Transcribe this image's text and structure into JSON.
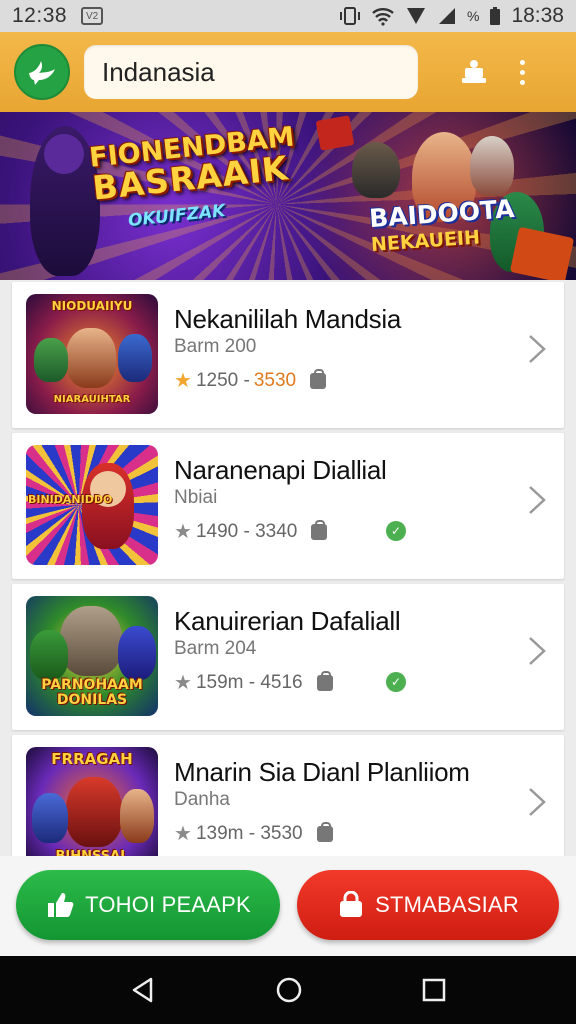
{
  "status_bar": {
    "time_left": "12:38",
    "battery_text": "%",
    "time_right": "18:38"
  },
  "app_bar": {
    "search_value": "Indanasia"
  },
  "banner": {
    "title_line1": "FIONENDBAM",
    "title_line2": "BASRAAIK",
    "subtitle": "OKUIFZAK",
    "right_line1": "BAIDOOTA",
    "right_line2": "NEKAUEIH"
  },
  "games": [
    {
      "title": "Nekanililah Mandsia",
      "subtitle": "Barm 200",
      "rating": "1250 -",
      "rating_hi": "3530",
      "verified": false,
      "thumb_text_top": "NIODUAIIYU",
      "thumb_text_bottom": "NIARAUIHTAR",
      "colors": {
        "bg1": "#d44b1a",
        "bg2": "#5b1a7a",
        "text": "#ffd23f"
      }
    },
    {
      "title": "Naranenapi Diallial",
      "subtitle": "Nbiai",
      "rating": "1490 - 3340",
      "rating_hi": "",
      "verified": true,
      "thumb_text_top": "BINIDANIDDO",
      "thumb_text_bottom": "",
      "colors": {
        "bg1": "#2a6bd6",
        "bg2": "#e0387a",
        "text": "#ffd23f"
      }
    },
    {
      "title": "Kanuirerian Dafaliall",
      "subtitle": "Barm 204",
      "rating": "159m - 4516",
      "rating_hi": "",
      "verified": true,
      "thumb_text_top": "",
      "thumb_text_bottom": "PARNOHAAM DONILAS",
      "colors": {
        "bg1": "#2f8a2a",
        "bg2": "#1c3f8c",
        "text": "#ffd23f"
      }
    },
    {
      "title": "Mnarin Sia Dianl Planliiom",
      "subtitle": "Danha",
      "rating": "139m - 3530",
      "rating_hi": "",
      "verified": false,
      "thumb_text_top": "FRRAGAH",
      "thumb_text_bottom": "BIHNSSAL",
      "colors": {
        "bg1": "#6a2ab8",
        "bg2": "#d03a22",
        "text": "#ffd23f"
      }
    }
  ],
  "buttons": {
    "primary_label": "TOHOI PEAAPK",
    "secondary_label": "STMABASIAR"
  },
  "colors": {
    "app_bar": "#eeac3a",
    "primary_button": "#1fa53e",
    "secondary_button": "#e02a1c",
    "star": "#f2a531",
    "rating_highlight": "#e07a1e"
  },
  "icons": {
    "logo": "bird-logo-icon",
    "appbar_action": "cart-icon",
    "menu": "more-vertical-icon",
    "primary_button": "thumbs-up-icon",
    "secondary_button": "bag-icon"
  }
}
